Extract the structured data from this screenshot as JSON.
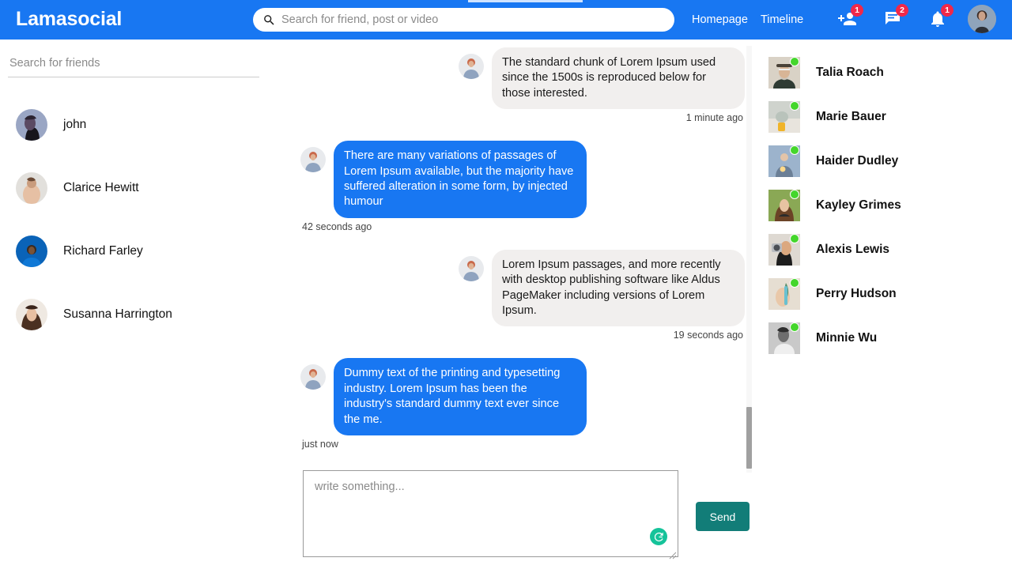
{
  "app": {
    "brand": "Lamasocial",
    "brand_color": "#1877F2",
    "accent_send_color": "#127D78",
    "badge_color": "#F02849",
    "online_dot_color": "#44D62C"
  },
  "header": {
    "search": {
      "placeholder": "Search for friend, post or video",
      "value": "",
      "icon": "search-icon"
    },
    "links": [
      {
        "label": "Homepage"
      },
      {
        "label": "Timeline"
      }
    ],
    "icons": [
      {
        "name": "person-icon",
        "badge": "1"
      },
      {
        "name": "chat-icon",
        "badge": "2"
      },
      {
        "name": "bell-icon",
        "badge": "1"
      }
    ],
    "avatar": {
      "name": "user-avatar"
    }
  },
  "left_sidebar": {
    "search": {
      "placeholder": "Search for friends",
      "value": ""
    },
    "conversations": [
      {
        "name": "john"
      },
      {
        "name": "Clarice Hewitt"
      },
      {
        "name": "Richard Farley"
      },
      {
        "name": "Susanna Harrington"
      }
    ]
  },
  "chat": {
    "messages": [
      {
        "own": false,
        "text": "The standard chunk of Lorem Ipsum used since the 1500s is reproduced below for those interested.",
        "time": "1 minute ago"
      },
      {
        "own": true,
        "text": "There are many variations of passages of Lorem Ipsum available, but the majority have suffered alteration in some form, by injected humour",
        "time": "42 seconds ago"
      },
      {
        "own": false,
        "text": "Lorem Ipsum passages, and more recently with desktop publishing software like Aldus PageMaker including versions of Lorem Ipsum.",
        "time": "19 seconds ago"
      },
      {
        "own": true,
        "text": "Dummy text of the printing and typesetting industry. Lorem Ipsum has been the industry's standard dummy text ever since the me.",
        "time": "just now"
      }
    ],
    "composer": {
      "placeholder": "write something...",
      "value": "",
      "send_label": "Send",
      "assistant_icon": "grammarly-icon"
    }
  },
  "right_sidebar": {
    "online_friends": [
      {
        "name": "Talia Roach",
        "online": true
      },
      {
        "name": "Marie Bauer",
        "online": true
      },
      {
        "name": "Haider Dudley",
        "online": true
      },
      {
        "name": "Kayley Grimes",
        "online": true
      },
      {
        "name": "Alexis Lewis",
        "online": true
      },
      {
        "name": "Perry Hudson",
        "online": true
      },
      {
        "name": "Minnie Wu",
        "online": true
      }
    ]
  }
}
